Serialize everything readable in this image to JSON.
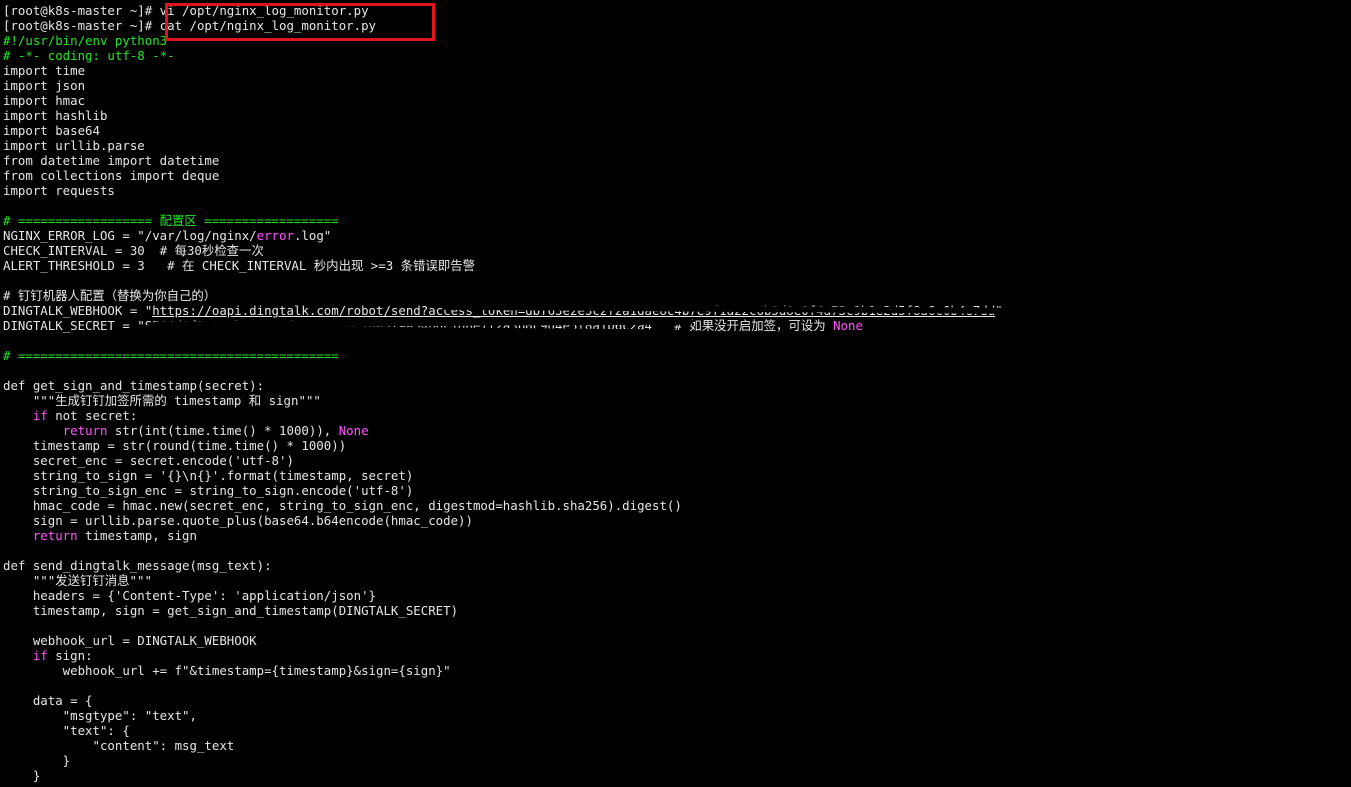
{
  "terminal": {
    "prompt": "[root@k8s-master ~]# ",
    "commands": [
      "vi /opt/nginx_log_monitor.py",
      "cat /opt/nginx_log_monitor.py"
    ],
    "lines": [
      [
        [
          "comment",
          "#!/usr/bin/env python3"
        ]
      ],
      [
        [
          "comment",
          "# -*- coding: utf-8 -*-"
        ]
      ],
      [
        [
          "text",
          "import time"
        ]
      ],
      [
        [
          "text",
          "import json"
        ]
      ],
      [
        [
          "text",
          "import hmac"
        ]
      ],
      [
        [
          "text",
          "import hashlib"
        ]
      ],
      [
        [
          "text",
          "import base64"
        ]
      ],
      [
        [
          "text",
          "import urllib.parse"
        ]
      ],
      [
        [
          "text",
          "from datetime import datetime"
        ]
      ],
      [
        [
          "text",
          "from collections import deque"
        ]
      ],
      [
        [
          "text",
          "import requests"
        ]
      ],
      [],
      [
        [
          "comment",
          "# ================== 配置区 =================="
        ]
      ],
      [
        [
          "text",
          "NGINX_ERROR_LOG = \"/var/log/nginx/"
        ],
        [
          "keyword",
          "error"
        ],
        [
          "text",
          ".log\""
        ]
      ],
      [
        [
          "text",
          "CHECK_INTERVAL = 30  # 每30秒检查一次"
        ]
      ],
      [
        [
          "text",
          "ALERT_THRESHOLD = 3   # 在 CHECK_INTERVAL 秒内出现 >=3 条错误即告警"
        ]
      ],
      [],
      [
        [
          "text",
          "# 钉钉机器人配置（替换为你自己的）"
        ]
      ],
      [
        [
          "text",
          "DINGTALK_WEBHOOK = \""
        ],
        [
          "url",
          "https://oapi.dingtalk.com/robot/send?access_token=dbf63e2e3c2f2a1dae8c4b7e9f1a22c6b5d8e0f4a73c9b1e2d5f8a6c0b4e7dd"
        ],
        [
          "text",
          "\""
        ]
      ],
      [
        [
          "text",
          "DINGTALK_SECRET = \"SEC4d1f7a8e0b2c93e5f6a14d7b8c20e3f9a54b6c1d8e7f2a3b0c9d4e5f8a1b6c2a4\"  # 如果没开启加签，可设为 "
        ],
        [
          "none",
          "None"
        ]
      ],
      [],
      [
        [
          "comment",
          "# ==========================================="
        ]
      ],
      [],
      [
        [
          "text",
          "def get_sign_and_timestamp(secret):"
        ]
      ],
      [
        [
          "text",
          "    \"\"\"生成钉钉加签所需的 timestamp 和 sign\"\"\""
        ]
      ],
      [
        [
          "text",
          "    "
        ],
        [
          "keyword",
          "if"
        ],
        [
          "text",
          " not secret:"
        ]
      ],
      [
        [
          "text",
          "        "
        ],
        [
          "keyword",
          "return"
        ],
        [
          "text",
          " str(int(time.time() * 1000)), "
        ],
        [
          "none",
          "None"
        ]
      ],
      [
        [
          "text",
          "    timestamp = str(round(time.time() * 1000))"
        ]
      ],
      [
        [
          "text",
          "    secret_enc = secret.encode('utf-8')"
        ]
      ],
      [
        [
          "text",
          "    string_to_sign = '{}\\n{}'.format(timestamp, secret)"
        ]
      ],
      [
        [
          "text",
          "    string_to_sign_enc = string_to_sign.encode('utf-8')"
        ]
      ],
      [
        [
          "text",
          "    hmac_code = hmac.new(secret_enc, string_to_sign_enc, digestmod=hashlib.sha256).digest()"
        ]
      ],
      [
        [
          "text",
          "    sign = urllib.parse.quote_plus(base64.b64encode(hmac_code))"
        ]
      ],
      [
        [
          "text",
          "    "
        ],
        [
          "keyword",
          "return"
        ],
        [
          "text",
          " timestamp, sign"
        ]
      ],
      [],
      [
        [
          "text",
          "def send_dingtalk_message(msg_text):"
        ]
      ],
      [
        [
          "text",
          "    \"\"\"发送钉钉消息\"\"\""
        ]
      ],
      [
        [
          "text",
          "    headers = {'Content-Type': 'application/json'}"
        ]
      ],
      [
        [
          "text",
          "    timestamp, sign = get_sign_and_timestamp(DINGTALK_SECRET)"
        ]
      ],
      [],
      [
        [
          "text",
          "    webhook_url = DINGTALK_WEBHOOK"
        ]
      ],
      [
        [
          "text",
          "    "
        ],
        [
          "keyword",
          "if"
        ],
        [
          "text",
          " sign:"
        ]
      ],
      [
        [
          "text",
          "        webhook_url += f\"&timestamp={timestamp}&sign={sign}\""
        ]
      ],
      [],
      [
        [
          "text",
          "    data = {"
        ]
      ],
      [
        [
          "text",
          "        \"msgtype\": \"text\","
        ]
      ],
      [
        [
          "text",
          "        \"text\": {"
        ]
      ],
      [
        [
          "text",
          "            \"content\": msg_text"
        ]
      ],
      [
        [
          "text",
          "        }"
        ]
      ],
      [
        [
          "text",
          "    }"
        ]
      ]
    ]
  },
  "colors": {
    "background": "#000000",
    "foreground": "#e6e6e6",
    "comment": "#22e622",
    "keyword": "#ff55ff",
    "highlight_box": "#e0141e"
  }
}
